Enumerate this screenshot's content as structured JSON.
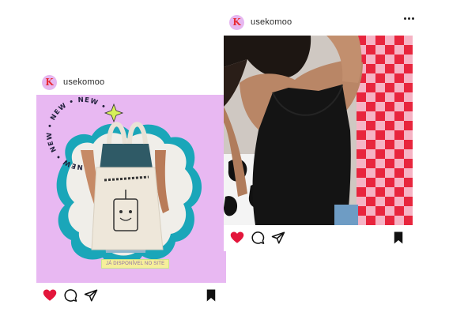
{
  "posts": [
    {
      "username": "usekomoo",
      "avatar_letter": "K",
      "image_caption_tag": "JÁ DISPONÍVEL NO SITE",
      "ring_text": "NEW • NEW • NEW • NEW •",
      "image_icon": "photo-tote-bag",
      "liked": true
    },
    {
      "username": "usekomoo",
      "avatar_letter": "K",
      "image_icon": "photo-black-top",
      "liked": true
    }
  ],
  "colors": {
    "like": "#e3163b",
    "avatar_bg": "#e6b6f0",
    "avatar_letter": "#e62a37",
    "back_bg": "#e8b8f2",
    "blob": "#1aa6b9",
    "checker_red": "#e8253d",
    "checker_pink": "#f6b3c4"
  },
  "icons": [
    "heart-icon",
    "comment-icon",
    "share-icon",
    "bookmark-icon",
    "more-icon"
  ]
}
